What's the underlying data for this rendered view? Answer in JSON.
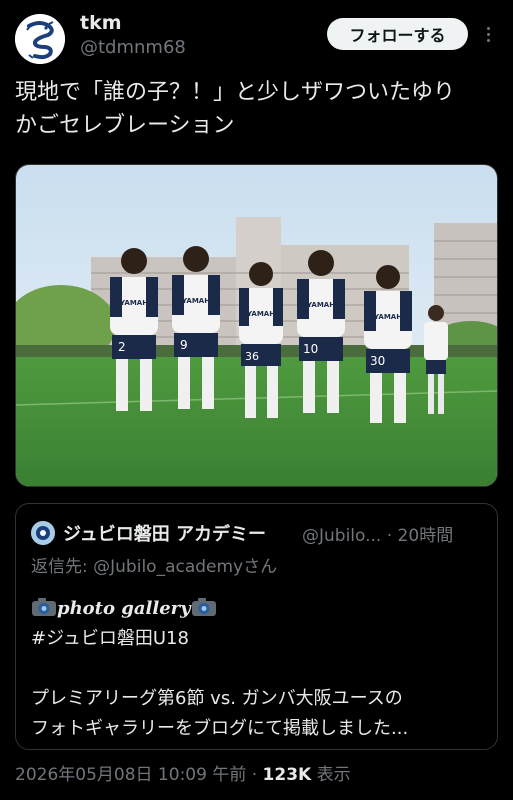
{
  "author": {
    "name": "tkm",
    "handle": "@tdmnm68",
    "follow_label": "フォローする"
  },
  "tweet": {
    "text_line1": "現地で「誰の子？！」と少しザワついたゆり",
    "text_line2": "かごセレブレーション"
  },
  "media": {
    "icon": "photo",
    "players": [
      {
        "number": "2",
        "shirt": "YAMAHA"
      },
      {
        "number": "9",
        "shirt": "YAMAHA"
      },
      {
        "number": "36",
        "shirt": "YAMAHA"
      },
      {
        "number": "10",
        "shirt": "YAMAHA"
      },
      {
        "number": "30",
        "shirt": "YAMAHA"
      }
    ],
    "colors": {
      "sky": "#d7e8f4",
      "grass": "#3f8a3a",
      "shirt": "#f4f4f4",
      "navy": "#1c2a4a"
    }
  },
  "quote": {
    "name": "ジュビロ磐田 アカデミー",
    "handle": "@Jubilo...",
    "time": "· 20時間",
    "reply_prefix": "返信先: ",
    "reply_to": "@Jubilo_academy",
    "reply_suffix": "さん",
    "gallery_label": "photo gallery",
    "hashtag": "#ジュビロ磐田U18",
    "body_line1": "プレミアリーグ第6節 vs. ガンバ大阪ユースの",
    "body_line2": "フォトギャラリーをブログにて掲載しました..."
  },
  "footer": {
    "timestamp": "2026年05月08日 10:09 午前",
    "separator": " · ",
    "views": "123K",
    "views_label": " 表示"
  }
}
